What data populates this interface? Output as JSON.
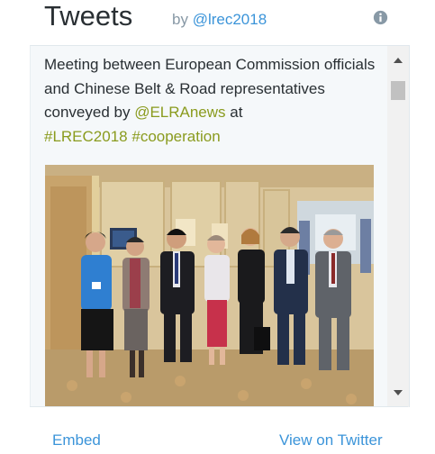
{
  "header": {
    "title": "Tweets",
    "by_prefix": "by",
    "handle": "@lrec2018",
    "info_icon": "info-icon"
  },
  "tweet": {
    "text_part1": "Meeting between European Commission officials and Chinese Belt & Road representatives conveyed by ",
    "mention": "@ELRAnews",
    "text_part2": " at ",
    "hashtag1": "#LREC2018",
    "hashtag2": "#cooperation",
    "photo_icon": "group-photo"
  },
  "scrollbar": {
    "up_icon": "triangle-up-icon",
    "down_icon": "triangle-down-icon"
  },
  "footer": {
    "embed_label": "Embed",
    "view_label": "View on Twitter"
  },
  "colors": {
    "link": "#3b94d9",
    "hashtag": "#8a9b1e",
    "text": "#292f33",
    "muted": "#8899a6"
  }
}
